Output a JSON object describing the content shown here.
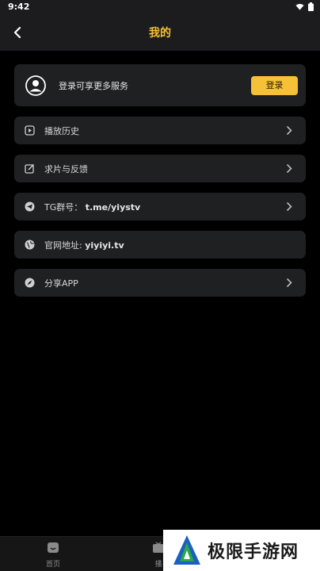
{
  "status_bar": {
    "time": "9:42"
  },
  "header": {
    "title": "我的"
  },
  "login_card": {
    "prompt": "登录可享更多服务",
    "button_label": "登录"
  },
  "menu": [
    {
      "icon": "play-history-icon",
      "label": "播放历史",
      "has_arrow": true
    },
    {
      "icon": "edit-feedback-icon",
      "label": "求片与反馈",
      "has_arrow": true
    },
    {
      "icon": "telegram-icon",
      "label_prefix": "TG群号：",
      "label_value": "t.me/yiystv",
      "has_arrow": true
    },
    {
      "icon": "globe-icon",
      "label_prefix": "官网地址:",
      "label_value": "yiyiyi.tv",
      "has_arrow": false
    },
    {
      "icon": "compass-share-icon",
      "label": "分享APP",
      "has_arrow": true
    }
  ],
  "bottom_nav": {
    "home_label": "首页",
    "play_label": "播"
  },
  "watermark": {
    "text": "极限手游网"
  },
  "colors": {
    "accent": "#f6c137",
    "background": "#000000",
    "card": "#1f2022"
  }
}
